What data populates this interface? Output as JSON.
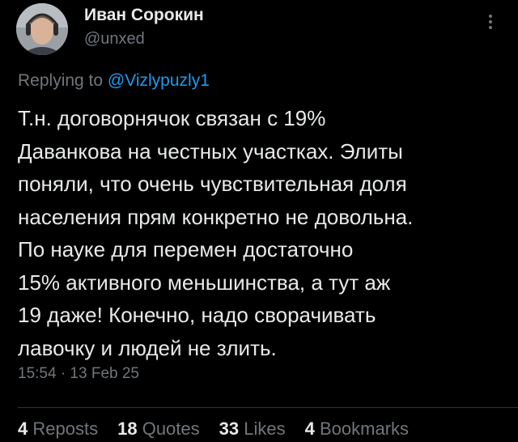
{
  "author": {
    "display_name": "Иван Сорокин",
    "handle": "@unxed"
  },
  "reply": {
    "prefix": "Replying to ",
    "mention": "@Vizlypuzly1"
  },
  "tweet": {
    "lines": [
      "Т.н. договорнячок связан с 19%",
      "Даванкова на честных участках. Элиты",
      "поняли, что очень чувствительная доля",
      "населения прям конкретно не довольна.",
      "По науке для перемен достаточно",
      "15% активного меньшинства, а тут аж",
      "19 даже! Конечно, надо сворачивать",
      "лавочку и людей не злить."
    ],
    "timestamp": "15:54 · 13 Feb 25"
  },
  "stats": {
    "reposts": {
      "count": "4",
      "label": "Reposts"
    },
    "quotes": {
      "count": "18",
      "label": "Quotes"
    },
    "likes": {
      "count": "33",
      "label": "Likes"
    },
    "bookmarks": {
      "count": "4",
      "label": "Bookmarks"
    }
  },
  "icons": {
    "more": "more-vertical-icon"
  },
  "colors": {
    "background": "#000000",
    "text_primary": "#e7e9ea",
    "text_secondary": "#71767b",
    "link": "#1d9bf0",
    "divider": "#2f3336"
  }
}
